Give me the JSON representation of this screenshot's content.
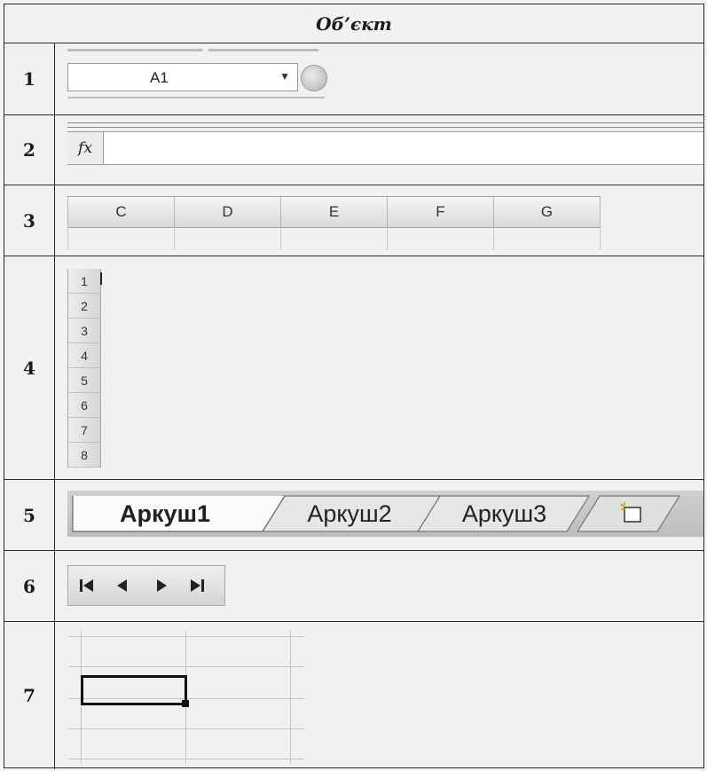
{
  "table": {
    "header_label": "Об’єкт",
    "rows": [
      {
        "number": "1",
        "object": "name-box"
      },
      {
        "number": "2",
        "object": "formula-bar"
      },
      {
        "number": "3",
        "object": "column-headers"
      },
      {
        "number": "4",
        "object": "row-headers"
      },
      {
        "number": "5",
        "object": "sheet-tabs"
      },
      {
        "number": "6",
        "object": "sheet-navigation-buttons"
      },
      {
        "number": "7",
        "object": "active-cell"
      }
    ]
  },
  "name_box": {
    "value": "A1"
  },
  "formula_bar": {
    "fx_label": "fx"
  },
  "column_headers": [
    "C",
    "D",
    "E",
    "F",
    "G"
  ],
  "row_headers": [
    "1",
    "2",
    "3",
    "4",
    "5",
    "6",
    "7",
    "8"
  ],
  "sheet_tabs": [
    "Аркуш1",
    "Аркуш2",
    "Аркуш3"
  ],
  "sheet_tabs_active": "Аркуш1",
  "nav_buttons": [
    "first-sheet-icon",
    "prev-sheet-icon",
    "next-sheet-icon",
    "last-sheet-icon"
  ],
  "colors": {
    "line": "#2a2a2a",
    "grid": "#c4c4c4",
    "cell_border": "#111111"
  }
}
